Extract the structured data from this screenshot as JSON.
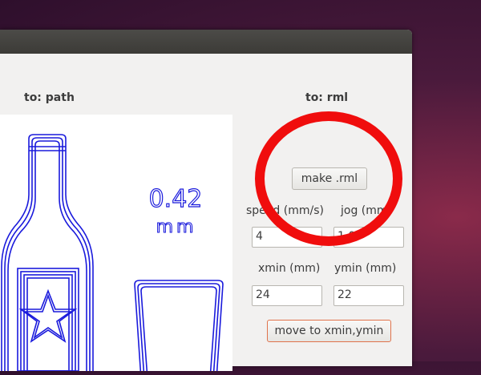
{
  "left_panel": {
    "title": "to: path"
  },
  "right_panel": {
    "title": "to: rml"
  },
  "preview": {
    "dimension_value": "0.42",
    "dimension_unit": "mm",
    "stroke_color": "#1a1adc"
  },
  "controls": {
    "make_button": "make .rml",
    "speed_label": "speed (mm/s)",
    "speed_value": "4",
    "jog_label": "jog (mm)",
    "jog_value": "1.0",
    "xmin_label": "xmin (mm)",
    "xmin_value": "24",
    "ymin_label": "ymin (mm)",
    "ymin_value": "22",
    "move_button": "move to xmin,ymin"
  },
  "annotation": {
    "color": "#f00d0d"
  }
}
